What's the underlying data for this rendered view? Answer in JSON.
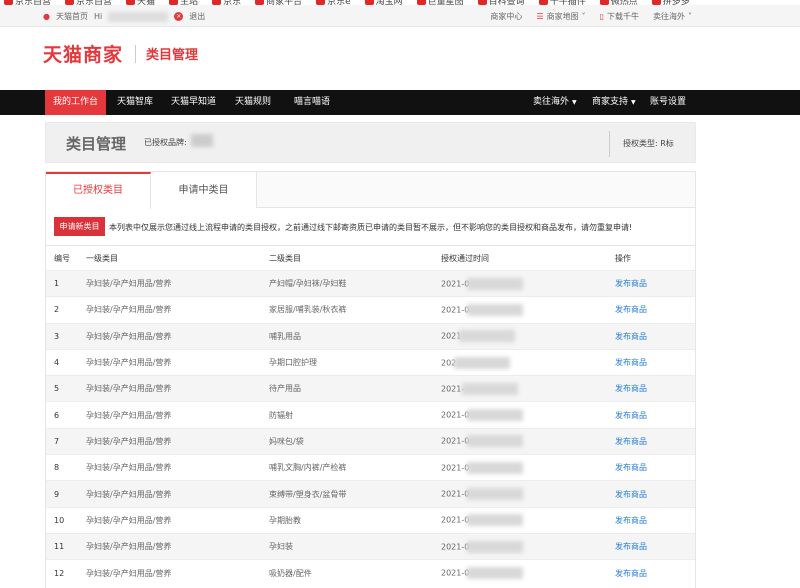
{
  "bookmarks": [
    "京东自营",
    "京东自营",
    "天猫",
    "主站",
    "京东",
    "商家平台",
    "京东e",
    "淘宝网",
    "巨量星图",
    "百科查询",
    "千牛插件",
    "微热点",
    "拼多多"
  ],
  "topnav": {
    "home": "天猫首页",
    "greeting": "Hi",
    "logout": "退出",
    "links": [
      "商家中心",
      "商家地图",
      "下载千牛",
      "卖往海外"
    ]
  },
  "brand": {
    "logo": "天猫商家",
    "subtitle": "类目管理"
  },
  "mainnav": {
    "left": [
      "我的工作台",
      "天猫智库",
      "天猫早知道",
      "天猫规则",
      "喵言喵语"
    ],
    "right": [
      "卖往海外",
      "商家支持",
      "账号设置"
    ]
  },
  "titlebar": {
    "title": "类目管理",
    "brand_label": "已授权品牌:",
    "auth_type": "授权类型: R标"
  },
  "tabs": [
    "已授权类目",
    "申请中类目"
  ],
  "apply_button": "申请新类目",
  "notice": "本列表中仅展示您通过线上流程申请的类目授权，之前通过线下邮寄资质已申请的类目暂不展示，但不影响您的类目授权和商品发布，请勿重复申请!",
  "table": {
    "columns": [
      "编号",
      "一级类目",
      "二级类目",
      "授权通过时间",
      "操作"
    ],
    "rows": [
      {
        "no": "1",
        "l1": "孕妇装/孕产妇用品/营养",
        "l2": "产妇帽/孕妇袜/孕妇鞋",
        "date": "2021-0",
        "op": "发布商品"
      },
      {
        "no": "2",
        "l1": "孕妇装/孕产妇用品/营养",
        "l2": "家居服/哺乳装/秋衣裤",
        "date": "2021-0",
        "op": "发布商品"
      },
      {
        "no": "3",
        "l1": "孕妇装/孕产妇用品/营养",
        "l2": "哺乳用品",
        "date": "2021",
        "op": "发布商品"
      },
      {
        "no": "4",
        "l1": "孕妇装/孕产妇用品/营养",
        "l2": "孕期口腔护理",
        "date": "202",
        "op": "发布商品"
      },
      {
        "no": "5",
        "l1": "孕妇装/孕产妇用品/营养",
        "l2": "待产用品",
        "date": "2021-",
        "op": "发布商品"
      },
      {
        "no": "6",
        "l1": "孕妇装/孕产妇用品/营养",
        "l2": "防辐射",
        "date": "2021-0",
        "op": "发布商品"
      },
      {
        "no": "7",
        "l1": "孕妇装/孕产妇用品/营养",
        "l2": "妈咪包/袋",
        "date": "2021-0",
        "op": "发布商品"
      },
      {
        "no": "8",
        "l1": "孕妇装/孕产妇用品/营养",
        "l2": "哺乳文胸/内裤/产检裤",
        "date": "2021-0",
        "op": "发布商品"
      },
      {
        "no": "9",
        "l1": "孕妇装/孕产妇用品/营养",
        "l2": "束缚带/塑身衣/盆骨带",
        "date": "2021-0",
        "op": "发布商品"
      },
      {
        "no": "10",
        "l1": "孕妇装/孕产妇用品/营养",
        "l2": "孕期胎教",
        "date": "2021-0",
        "op": "发布商品"
      },
      {
        "no": "11",
        "l1": "孕妇装/孕产妇用品/营养",
        "l2": "孕妇装",
        "date": "2021-0",
        "op": "发布商品"
      },
      {
        "no": "12",
        "l1": "孕妇装/孕产妇用品/营养",
        "l2": "吸奶器/配件",
        "date": "2021-0",
        "op": "发布商品"
      }
    ]
  },
  "colors": {
    "accent": "#e4393c",
    "nav_bg": "#111111",
    "link": "#2a7ddb"
  }
}
